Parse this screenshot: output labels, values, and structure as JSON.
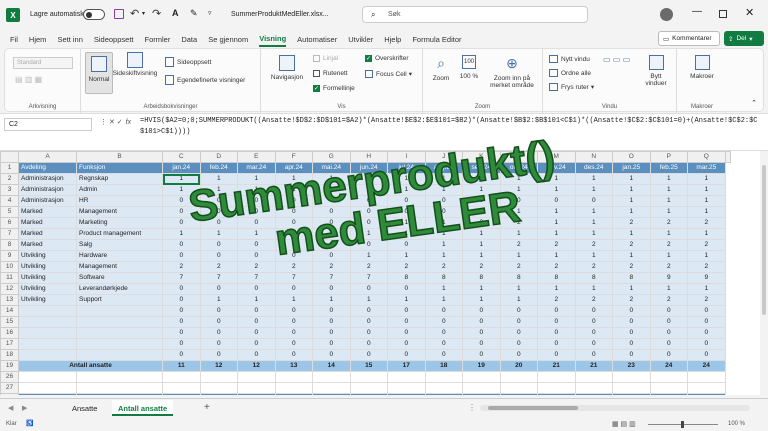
{
  "titlebar": {
    "autosave_label": "Lagre automatisk",
    "filename": "SummerProduktMedEller.xlsx...",
    "search_placeholder": "Søk"
  },
  "tabs": [
    "Fil",
    "Hjem",
    "Sett inn",
    "Sideoppsett",
    "Formler",
    "Data",
    "Se gjennom",
    "Visning",
    "Automatiser",
    "Utvikler",
    "Hjelp",
    "Formula Editor"
  ],
  "active_tab": "Visning",
  "header_buttons": {
    "comments": "Kommentarer",
    "share": "Del"
  },
  "ribbon": {
    "sheetview": {
      "dropdown": "Standard",
      "label": "Arkvisning"
    },
    "workbookviews": {
      "normal": "Normal",
      "pagebreak": "Sideskiftvisning",
      "pagelayout": "Sideoppsett",
      "custom": "Egendefinerte visninger",
      "label": "Arbeidsbokvisninger"
    },
    "show": {
      "navigation": "Navigasjon",
      "ruler": "Linjal",
      "gridlines": "Rutenett",
      "headings": "Overskrifter",
      "formulabar": "Formellinje",
      "focuscell": "Focus Cell",
      "label": "Vis"
    },
    "zoom": {
      "zoom": "Zoom",
      "zoom100": "100 %",
      "selection": "Zoom inn på merket område",
      "label": "Zoom"
    },
    "window": {
      "new": "Nytt vindu",
      "arrange": "Ordne alle",
      "freeze": "Frys ruter",
      "switch": "Bytt vinduer",
      "label": "Vindu"
    },
    "macros": {
      "macros": "Makroer",
      "label": "Makroer"
    }
  },
  "formula_bar": {
    "namebox": "C2",
    "formula": "=HVIS($A2=0;0;SUMMERPRODUKT((Ansatte!$D$2:$D$101=$A2)*(Ansatte!$E$2:$E$101=$B2)*(Ansatte!$B$2:$B$101<C$1)*((Ansatte!$C$2:$C$101=0)+(Ansatte!$C$2:$C$101>C$1))))"
  },
  "columns": [
    "A",
    "B",
    "C",
    "D",
    "E",
    "F",
    "G",
    "H",
    "I",
    "J",
    "K",
    "L",
    "M",
    "N",
    "O",
    "P",
    "Q"
  ],
  "months": [
    "jan.24",
    "feb.24",
    "mar.24",
    "apr.24",
    "mai.24",
    "jun.24",
    "jul.24",
    "aug.24",
    "sep.24",
    "okt.24",
    "nov.24",
    "des.24",
    "jan.25",
    "feb.25",
    "mar.25"
  ],
  "header_row": {
    "a": "Avdeling",
    "b": "Funksjon"
  },
  "rows": [
    {
      "a": "Administrasjon",
      "b": "Regnskap",
      "v": [
        "1",
        "1",
        "1",
        "1",
        "1",
        "1",
        "1",
        "1",
        "1",
        "1",
        "1",
        "1",
        "1",
        "1",
        "1"
      ]
    },
    {
      "a": "Administrasjon",
      "b": "Admin",
      "v": [
        "1",
        "1",
        "1",
        "1",
        "1",
        "1",
        "1",
        "1",
        "1",
        "1",
        "1",
        "1",
        "1",
        "1",
        "1"
      ]
    },
    {
      "a": "Administrasjon",
      "b": "HR",
      "v": [
        "0",
        "0",
        "0",
        "0",
        "0",
        "0",
        "0",
        "0",
        "0",
        "0",
        "0",
        "0",
        "1",
        "1",
        "1"
      ]
    },
    {
      "a": "Marked",
      "b": "Management",
      "v": [
        "0",
        "0",
        "0",
        "0",
        "0",
        "0",
        "0",
        "0",
        "1",
        "1",
        "1",
        "1",
        "1",
        "1",
        "1"
      ]
    },
    {
      "a": "Marked",
      "b": "Marketing",
      "v": [
        "0",
        "0",
        "0",
        "0",
        "0",
        "0",
        "1",
        "1",
        "2",
        "2",
        "1",
        "1",
        "2",
        "2",
        "2"
      ]
    },
    {
      "a": "Marked",
      "b": "Product management",
      "v": [
        "1",
        "1",
        "1",
        "1",
        "1",
        "1",
        "1",
        "1",
        "1",
        "1",
        "1",
        "1",
        "1",
        "1",
        "1"
      ]
    },
    {
      "a": "Marked",
      "b": "Salg",
      "v": [
        "0",
        "0",
        "0",
        "0",
        "0",
        "0",
        "0",
        "1",
        "1",
        "2",
        "2",
        "2",
        "2",
        "2",
        "2"
      ]
    },
    {
      "a": "Utvikling",
      "b": "Hardware",
      "v": [
        "0",
        "0",
        "0",
        "0",
        "0",
        "1",
        "1",
        "1",
        "1",
        "1",
        "1",
        "1",
        "1",
        "1",
        "1"
      ]
    },
    {
      "a": "Utvikling",
      "b": "Management",
      "v": [
        "2",
        "2",
        "2",
        "2",
        "2",
        "2",
        "2",
        "2",
        "2",
        "2",
        "2",
        "2",
        "2",
        "2",
        "2"
      ]
    },
    {
      "a": "Utvikling",
      "b": "Software",
      "v": [
        "7",
        "7",
        "7",
        "7",
        "7",
        "7",
        "8",
        "8",
        "8",
        "8",
        "8",
        "8",
        "8",
        "9",
        "9"
      ]
    },
    {
      "a": "Utvikling",
      "b": "Leverandørkjede",
      "v": [
        "0",
        "0",
        "0",
        "0",
        "0",
        "0",
        "0",
        "1",
        "1",
        "1",
        "1",
        "1",
        "1",
        "1",
        "1"
      ]
    },
    {
      "a": "Utvikling",
      "b": "Support",
      "v": [
        "0",
        "1",
        "1",
        "1",
        "1",
        "1",
        "1",
        "1",
        "1",
        "1",
        "2",
        "2",
        "2",
        "2",
        "2"
      ]
    },
    {
      "a": "",
      "b": "",
      "v": [
        "0",
        "0",
        "0",
        "0",
        "0",
        "0",
        "0",
        "0",
        "0",
        "0",
        "0",
        "0",
        "0",
        "0",
        "0"
      ]
    },
    {
      "a": "",
      "b": "",
      "v": [
        "0",
        "0",
        "0",
        "0",
        "0",
        "0",
        "0",
        "0",
        "0",
        "0",
        "0",
        "0",
        "0",
        "0",
        "0"
      ]
    },
    {
      "a": "",
      "b": "",
      "v": [
        "0",
        "0",
        "0",
        "0",
        "0",
        "0",
        "0",
        "0",
        "0",
        "0",
        "0",
        "0",
        "0",
        "0",
        "0"
      ]
    },
    {
      "a": "",
      "b": "",
      "v": [
        "0",
        "0",
        "0",
        "0",
        "0",
        "0",
        "0",
        "0",
        "0",
        "0",
        "0",
        "0",
        "0",
        "0",
        "0"
      ]
    },
    {
      "a": "",
      "b": "",
      "v": [
        "0",
        "0",
        "0",
        "0",
        "0",
        "0",
        "0",
        "0",
        "0",
        "0",
        "0",
        "0",
        "0",
        "0",
        "0"
      ]
    }
  ],
  "total": {
    "label": "Antall ansatte",
    "v": [
      "11",
      "12",
      "12",
      "13",
      "14",
      "15",
      "17",
      "18",
      "19",
      "20",
      "21",
      "21",
      "23",
      "24",
      "24"
    ]
  },
  "row_numbers": [
    "1",
    "2",
    "3",
    "4",
    "5",
    "6",
    "7",
    "8",
    "9",
    "10",
    "11",
    "12",
    "13",
    "14",
    "15",
    "16",
    "17",
    "18",
    "19",
    "26",
    "27",
    "28"
  ],
  "overlay": {
    "line1": "Summerprodukt()",
    "line2": "med ELLER"
  },
  "sheet_tabs": [
    "Ansatte",
    "Antall ansatte"
  ],
  "active_sheet": "Antall ansatte",
  "status": {
    "ready": "Klar",
    "zoom": "100 %"
  }
}
